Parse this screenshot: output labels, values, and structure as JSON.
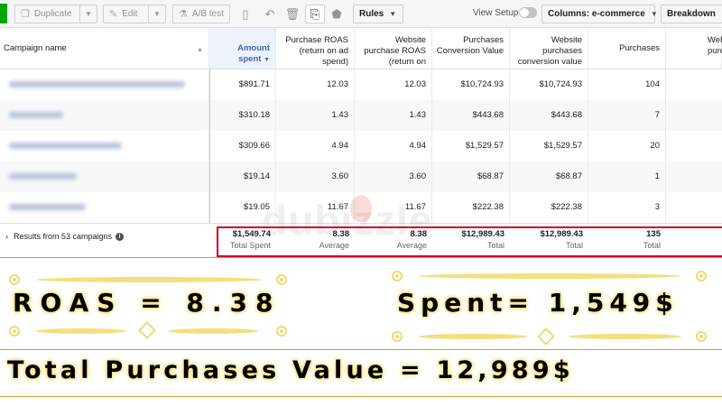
{
  "toolbar": {
    "duplicate_label": "Duplicate",
    "edit_label": "Edit",
    "abtest_label": "A/B test",
    "rules_label": "Rules",
    "view_setup_label": "View Setup",
    "columns_label": "Columns: e-commerce",
    "breakdown_label": "Breakdown",
    "icons": [
      "copy-icon",
      "pencil-icon",
      "flask-icon",
      "trash-icon",
      "undo-icon",
      "delete-icon",
      "chart-icon",
      "tag-icon"
    ]
  },
  "table": {
    "headers": {
      "campaign_name": "Campaign name",
      "amount_spent": "Amount spent",
      "purchase_roas": "Purchase ROAS (return on ad spend)",
      "website_purchase_roas": "Website purchase ROAS (return on",
      "purchases_conv_value": "Purchases Conversion Value",
      "website_purchases_conv_value": "Website purchases conversion value",
      "purchases": "Purchases",
      "website_purchases_partial": "Web purcha"
    },
    "rows": [
      {
        "spent": "$891.71",
        "roas": "12.03",
        "web_roas": "12.03",
        "conv_value": "$10,724.93",
        "web_conv_value": "$10,724.93",
        "purchases": "104"
      },
      {
        "spent": "$310.18",
        "roas": "1.43",
        "web_roas": "1.43",
        "conv_value": "$443.68",
        "web_conv_value": "$443.68",
        "purchases": "7"
      },
      {
        "spent": "$309.66",
        "roas": "4.94",
        "web_roas": "4.94",
        "conv_value": "$1,529.57",
        "web_conv_value": "$1,529.57",
        "purchases": "20"
      },
      {
        "spent": "$19.14",
        "roas": "3.60",
        "web_roas": "3.60",
        "conv_value": "$68.87",
        "web_conv_value": "$68.87",
        "purchases": "1"
      },
      {
        "spent": "$19.05",
        "roas": "11.67",
        "web_roas": "11.67",
        "conv_value": "$222.38",
        "web_conv_value": "$222.38",
        "purchases": "3"
      }
    ],
    "summary": {
      "label": "Results from 53 campaigns",
      "spent": "$1,549.74",
      "spent_sub": "Total Spent",
      "roas": "8.38",
      "roas_sub": "Average",
      "web_roas": "8.38",
      "web_roas_sub": "Average",
      "conv_value": "$12,989.43",
      "conv_value_sub": "Total",
      "web_conv_value": "$12,989.43",
      "web_conv_value_sub": "Total",
      "purchases": "135",
      "purchases_sub": "Total"
    }
  },
  "watermark": "dubizzle",
  "banner": {
    "roas_text": "ROAS = 8.38",
    "spent_text": "Spent= 1,549$",
    "total_text": "Total Purchases Value = 12,989$"
  },
  "colors": {
    "accent_blue": "#4267b2",
    "highlight_red": "#d0021b",
    "glow_yellow": "#f3df7d",
    "status_green": "#00a400"
  }
}
